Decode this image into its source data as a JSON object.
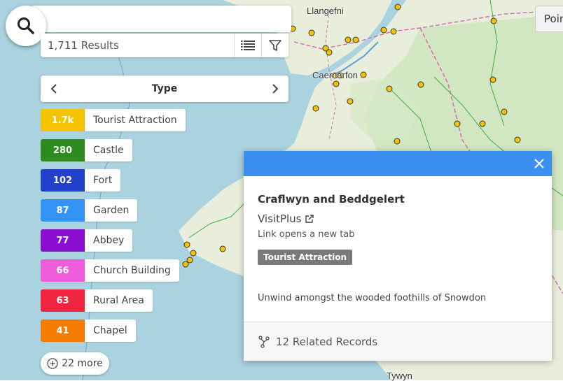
{
  "map": {
    "place_labels": [
      "Llangefni",
      "Caernarfon",
      "Tywyn"
    ],
    "colors": {
      "sea": "#aad3df",
      "land": "#e9eedc",
      "green": "#c9e4b8",
      "marker": "#f5c400",
      "boundary": "#d36fb0",
      "route": "#3bb03b"
    }
  },
  "search": {
    "icon": "search-icon"
  },
  "results": {
    "text": "1,711 Results",
    "list_icon": "list-icon",
    "filter_icon": "filter-icon"
  },
  "type_bar": {
    "title": "Type",
    "prev_icon": "chevron-left-icon",
    "next_icon": "chevron-right-icon"
  },
  "categories": [
    {
      "count": "1.7k",
      "label": "Tourist Attraction",
      "color": "#f5c400"
    },
    {
      "count": "280",
      "label": "Castle",
      "color": "#2e8b1f"
    },
    {
      "count": "102",
      "label": "Fort",
      "color": "#2240c9"
    },
    {
      "count": "87",
      "label": "Garden",
      "color": "#3394f5"
    },
    {
      "count": "77",
      "label": "Abbey",
      "color": "#8a0fd1"
    },
    {
      "count": "66",
      "label": "Church Building",
      "color": "#f05bdc"
    },
    {
      "count": "63",
      "label": "Rural Area",
      "color": "#f0243f"
    },
    {
      "count": "41",
      "label": "Chapel",
      "color": "#f57c00"
    }
  ],
  "more": {
    "label": "22 more"
  },
  "point_button": {
    "label": "Poin"
  },
  "popup": {
    "title": "Craflwyn and Beddgelert",
    "link_text": "VisitPlus",
    "link_note": "Link opens a new tab",
    "badge": "Tourist Attraction",
    "description": "Unwind amongst the wooded foothills of Snowdon",
    "related": "12 Related Records"
  }
}
